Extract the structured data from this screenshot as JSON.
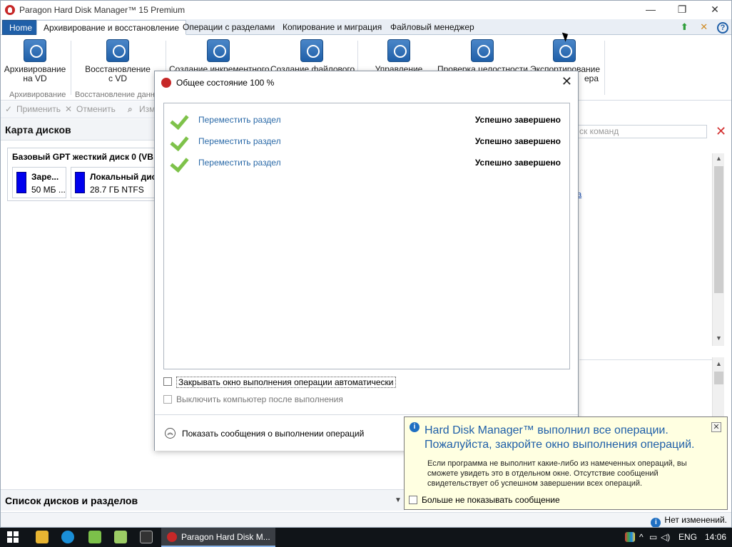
{
  "window": {
    "title": "Paragon Hard Disk Manager™ 15 Premium",
    "minimize": "—",
    "restore": "❐",
    "close": "✕"
  },
  "ribbon_tabs": [
    {
      "label": "Home"
    },
    {
      "label": "Архивирование и восстановление"
    },
    {
      "label": "Операции с разделами"
    },
    {
      "label": "Копирование и миграция"
    },
    {
      "label": "Файловый менеджер"
    }
  ],
  "ribbon_buttons": [
    {
      "label": "Архивирование\nна VD"
    },
    {
      "label": "Восстановление\nс VD"
    },
    {
      "label": "Создание инкрементного"
    },
    {
      "label": "Создание файлового"
    },
    {
      "label": "Управление"
    },
    {
      "label": "Проверка целостности"
    },
    {
      "label": "Экспортирование\nера"
    }
  ],
  "ribbon_groups": [
    "Архивирование",
    "Восстановление данн"
  ],
  "toolbar": {
    "apply": "Применить",
    "cancel": "Отменить",
    "change": "Изм"
  },
  "disk_map": {
    "title": "Карта дисков",
    "disk_title": "Базовый GPT жесткий диск 0 (VB",
    "partitions": [
      {
        "name": "Заре...",
        "size": "50 МБ ..."
      },
      {
        "name": "Локальный дис",
        "size": "28.7 ГБ NTFS"
      }
    ]
  },
  "search": {
    "placeholder": "ск команд"
  },
  "bottom_panel": {
    "title": "Список дисков и разделов"
  },
  "status": {
    "text": "Нет изменений."
  },
  "dialog": {
    "title": "Общее состояние 100 %",
    "operations": [
      {
        "name": "Переместить раздел",
        "status": "Успешно завершено"
      },
      {
        "name": "Переместить раздел",
        "status": "Успешно завершено"
      },
      {
        "name": "Переместить раздел",
        "status": "Успешно завершено"
      }
    ],
    "auto_close_label": "Закрывать окно выполнения операции автоматически",
    "shutdown_label": "Выключить компьютер после выполнения",
    "show_messages_label": "Показать сообщения о выполнении операций"
  },
  "notification": {
    "heading": "Hard Disk Manager™ выполнил все операции. Пожалуйста, закройте окно выполнения операций.",
    "body": "Если программа не выполнит какие-либо из намеченных операций, вы сможете увидеть это в отдельном окне. Отсутствие сообщений свидетельствует об успешном завершении всех операций.",
    "dont_show_label": "Больше не показывать сообщение"
  },
  "taskbar": {
    "app_label": "Paragon Hard Disk M...",
    "lang": "ENG",
    "time": "14:06"
  },
  "colors": {
    "accent": "#1f5fa8",
    "success_check": "#7ec24a",
    "notification_bg": "#ffffe1",
    "partition_bar": "#0000ee"
  }
}
